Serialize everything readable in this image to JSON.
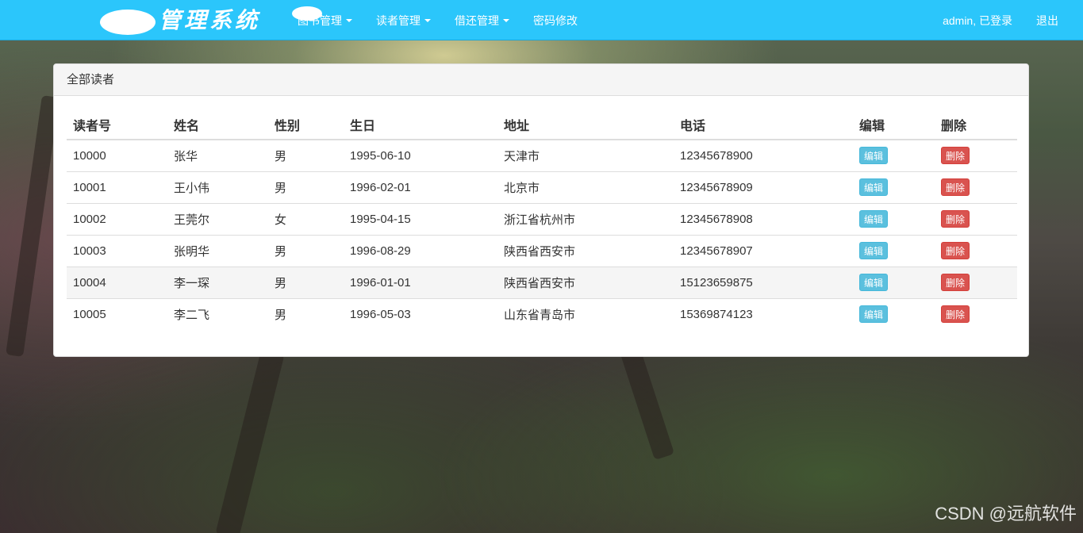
{
  "brand": {
    "title": "管理系统"
  },
  "nav": {
    "items": [
      {
        "label": "图书管理",
        "dropdown": true
      },
      {
        "label": "读者管理",
        "dropdown": true
      },
      {
        "label": "借还管理",
        "dropdown": true
      },
      {
        "label": "密码修改",
        "dropdown": false
      }
    ],
    "user_status": "admin, 已登录",
    "logout": "退出"
  },
  "panel": {
    "title": "全部读者"
  },
  "table": {
    "headers": [
      "读者号",
      "姓名",
      "性别",
      "生日",
      "地址",
      "电话",
      "编辑",
      "删除"
    ],
    "edit_label": "编辑",
    "delete_label": "删除",
    "rows": [
      {
        "id": "10000",
        "name": "张华",
        "gender": "男",
        "birthday": "1995-06-10",
        "address": "天津市",
        "phone": "12345678900"
      },
      {
        "id": "10001",
        "name": "王小伟",
        "gender": "男",
        "birthday": "1996-02-01",
        "address": "北京市",
        "phone": "12345678909"
      },
      {
        "id": "10002",
        "name": "王莞尔",
        "gender": "女",
        "birthday": "1995-04-15",
        "address": "浙江省杭州市",
        "phone": "12345678908"
      },
      {
        "id": "10003",
        "name": "张明华",
        "gender": "男",
        "birthday": "1996-08-29",
        "address": "陕西省西安市",
        "phone": "12345678907"
      },
      {
        "id": "10004",
        "name": "李一琛",
        "gender": "男",
        "birthday": "1996-01-01",
        "address": "陕西省西安市",
        "phone": "15123659875"
      },
      {
        "id": "10005",
        "name": "李二飞",
        "gender": "男",
        "birthday": "1996-05-03",
        "address": "山东省青岛市",
        "phone": "15369874123"
      }
    ]
  },
  "watermark": "CSDN @远航软件",
  "colors": {
    "navbar": "#2bc6fb",
    "edit_button": "#5bc0de",
    "delete_button": "#d9534f"
  }
}
